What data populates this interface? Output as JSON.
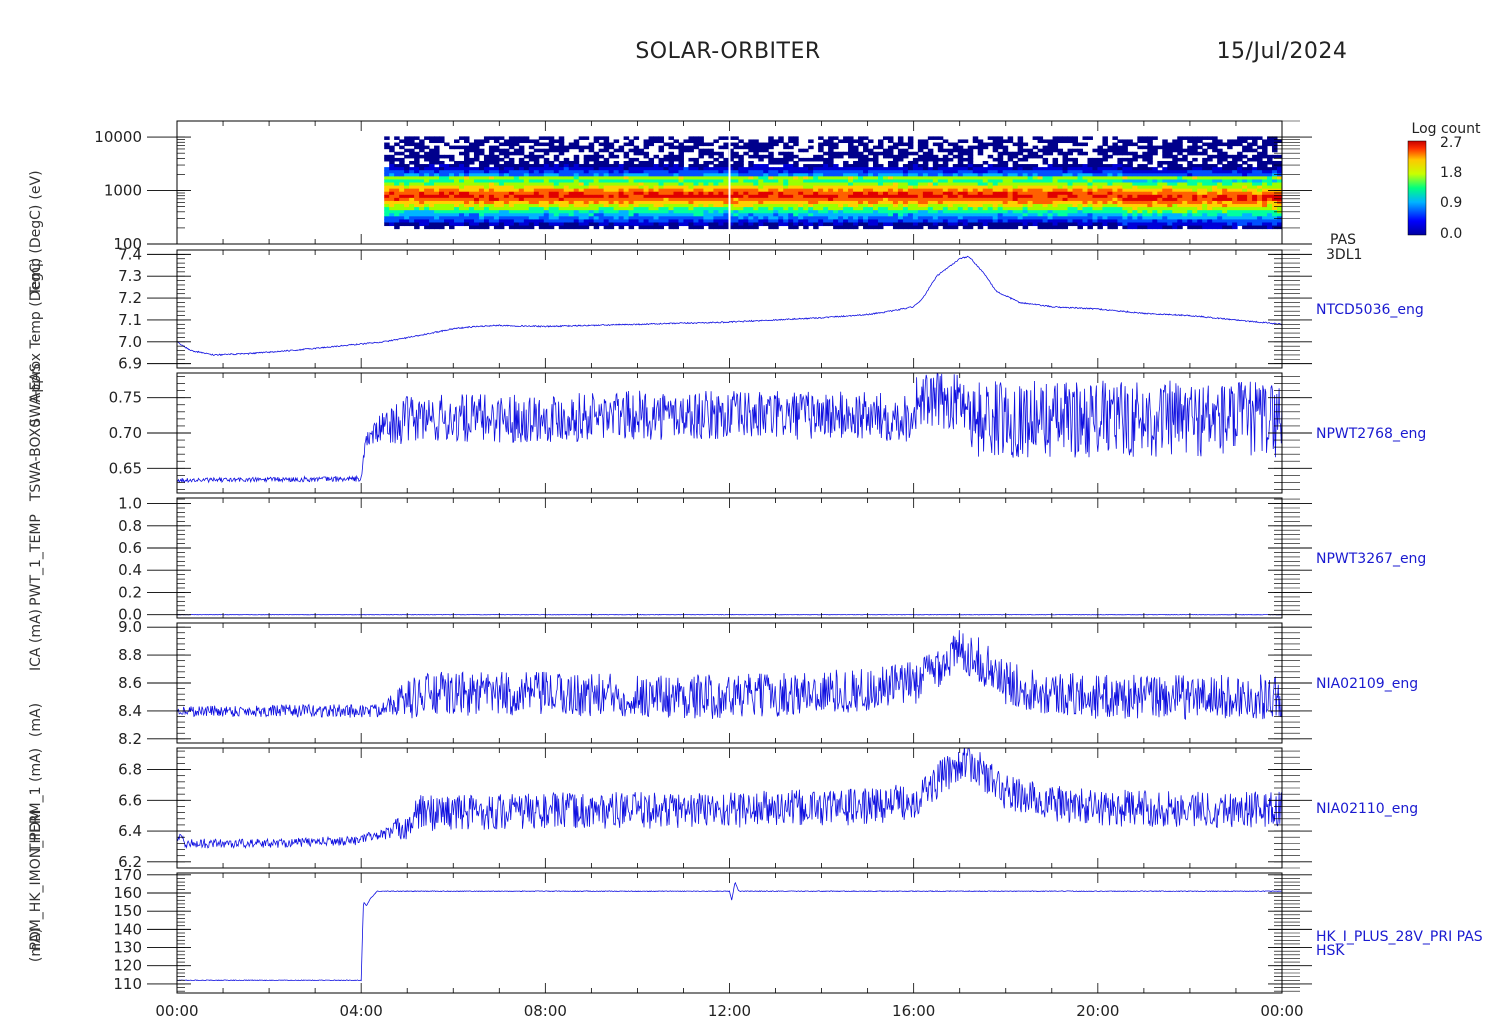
{
  "header": {
    "mission": "SOLAR-ORBITER",
    "date": "15/Jul/2024"
  },
  "colorbar": {
    "title": "Log count",
    "ticks": [
      "2.7",
      "1.8",
      "0.9",
      "0.0"
    ]
  },
  "ylabel_overlap": [
    "(eV)",
    "Temp (DegC)",
    "Approx Temp (DegC)",
    "SWA-EAS",
    "TSWA-BOX0",
    "PWT_1_TEMP",
    "ICA (mA)",
    "(mA)",
    "THERM_1 (mA)",
    "PDM_HK_IMON_PDM",
    "(mA)"
  ],
  "chart_data": {
    "type": "line",
    "x": {
      "tick_labels": [
        "00:00",
        "04:00",
        "08:00",
        "12:00",
        "16:00",
        "20:00",
        "00:00"
      ],
      "tick_hours": [
        0,
        4,
        8,
        12,
        16,
        20,
        24
      ],
      "range_hours": [
        0,
        24
      ]
    },
    "panels": [
      {
        "id": "pas-3dl1",
        "kind": "spectrogram",
        "name_lines": [
          "PAS",
          "3DL1"
        ],
        "scale": "log",
        "ylim": [
          100,
          20000
        ],
        "yticks": [
          100,
          1000,
          10000
        ],
        "ytick_labels": [
          "100",
          "1000",
          "10000"
        ],
        "data_start_hour": 4.5,
        "core_energy_band": [
          600,
          2000
        ],
        "peak_energy": 800
      },
      {
        "id": "ntcd5036",
        "name_lines": [
          "NTCD5036_eng"
        ],
        "ylim": [
          6.88,
          7.42
        ],
        "yticks": [
          6.9,
          7.0,
          7.1,
          7.2,
          7.3,
          7.4
        ],
        "ytick_labels": [
          "6.9",
          "7.0",
          "7.1",
          "7.2",
          "7.3",
          "7.4"
        ],
        "x": [
          0,
          0.3,
          0.8,
          1.5,
          2.5,
          3.5,
          4.5,
          5.3,
          6,
          6.5,
          7,
          8,
          10,
          12,
          14,
          15,
          15.5,
          16,
          16.2,
          16.5,
          17.0,
          17.2,
          17.5,
          17.8,
          18.3,
          19,
          20,
          21,
          22,
          23,
          24
        ],
        "y": [
          7.0,
          6.96,
          6.94,
          6.945,
          6.96,
          6.98,
          7.0,
          7.03,
          7.06,
          7.07,
          7.075,
          7.07,
          7.08,
          7.09,
          7.11,
          7.125,
          7.14,
          7.16,
          7.2,
          7.3,
          7.38,
          7.39,
          7.32,
          7.23,
          7.18,
          7.16,
          7.15,
          7.13,
          7.12,
          7.1,
          7.08
        ],
        "noise": 0.003
      },
      {
        "id": "npwt2768",
        "name_lines": [
          "NPWT2768_eng"
        ],
        "ylim": [
          0.615,
          0.785
        ],
        "yticks": [
          0.65,
          0.7,
          0.75
        ],
        "ytick_labels": [
          "0.65",
          "0.70",
          "0.75"
        ],
        "x": [
          0,
          4.0,
          4.1,
          4.5,
          5.2,
          6,
          8,
          10,
          12,
          14,
          16,
          16.05,
          17.2,
          17.25,
          20,
          24
        ],
        "y": [
          0.633,
          0.635,
          0.69,
          0.71,
          0.72,
          0.72,
          0.722,
          0.725,
          0.725,
          0.725,
          0.722,
          0.745,
          0.745,
          0.72,
          0.72,
          0.72
        ],
        "noise_x": [
          0,
          4.0,
          4.1,
          5.0,
          16.0,
          16.05,
          17.2,
          17.25,
          24
        ],
        "noise": [
          0.003,
          0.004,
          0.012,
          0.035,
          0.035,
          0.04,
          0.04,
          0.055,
          0.055
        ]
      },
      {
        "id": "npwt3267",
        "name_lines": [
          "NPWT3267_eng"
        ],
        "ylim": [
          -0.03,
          1.05
        ],
        "yticks": [
          0.0,
          0.2,
          0.4,
          0.6,
          0.8,
          1.0
        ],
        "ytick_labels": [
          "0.0",
          "0.2",
          "0.4",
          "0.6",
          "0.8",
          "1.0"
        ],
        "x": [
          0,
          24
        ],
        "y": [
          0.0,
          0.0
        ],
        "noise": 0.002
      },
      {
        "id": "nia02109",
        "name_lines": [
          "NIA02109_eng"
        ],
        "ylim": [
          8.17,
          9.03
        ],
        "yticks": [
          8.2,
          8.4,
          8.6,
          8.8,
          9.0
        ],
        "ytick_labels": [
          "8.2",
          "8.4",
          "8.6",
          "8.8",
          "9.0"
        ],
        "x": [
          0,
          4.4,
          4.5,
          5.2,
          5.5,
          8,
          12,
          15,
          16,
          16.5,
          17.0,
          17.3,
          18,
          19,
          20,
          24
        ],
        "y": [
          8.4,
          8.4,
          8.45,
          8.5,
          8.52,
          8.52,
          8.5,
          8.55,
          8.6,
          8.72,
          8.83,
          8.8,
          8.6,
          8.53,
          8.5,
          8.5
        ],
        "noise_x": [
          0,
          4.4,
          5.2,
          24
        ],
        "noise": [
          0.04,
          0.05,
          0.16,
          0.16
        ]
      },
      {
        "id": "nia02110",
        "name_lines": [
          "NIA02110_eng"
        ],
        "ylim": [
          6.16,
          6.94
        ],
        "yticks": [
          6.2,
          6.4,
          6.6,
          6.8
        ],
        "ytick_labels": [
          "6.2",
          "6.4",
          "6.6",
          "6.8"
        ],
        "x": [
          0,
          0.2,
          2,
          4,
          4.1,
          4.5,
          5,
          5.3,
          8,
          12,
          15,
          16,
          16.5,
          17.0,
          17.3,
          18,
          19,
          20,
          24
        ],
        "y": [
          6.37,
          6.32,
          6.32,
          6.34,
          6.36,
          6.38,
          6.44,
          6.52,
          6.53,
          6.54,
          6.56,
          6.6,
          6.72,
          6.85,
          6.83,
          6.65,
          6.58,
          6.55,
          6.54
        ],
        "noise_x": [
          0,
          4.4,
          5.2,
          24
        ],
        "noise": [
          0.03,
          0.03,
          0.12,
          0.12
        ]
      },
      {
        "id": "hk-i-plus-28v",
        "name_lines": [
          "HK_I_PLUS_28V_PRI PAS",
          "HSK"
        ],
        "ylim": [
          105,
          171
        ],
        "yticks": [
          110,
          120,
          130,
          140,
          150,
          160,
          170
        ],
        "ytick_labels": [
          "110",
          "120",
          "130",
          "140",
          "150",
          "160",
          "170"
        ],
        "x": [
          0,
          4.0,
          4.05,
          4.12,
          4.2,
          4.35,
          4.5,
          12.0,
          12.05,
          12.12,
          12.2,
          24
        ],
        "y": [
          112,
          112,
          155,
          153,
          157,
          161,
          161,
          161,
          156,
          166,
          161,
          161
        ],
        "noise": 0.2
      }
    ]
  }
}
